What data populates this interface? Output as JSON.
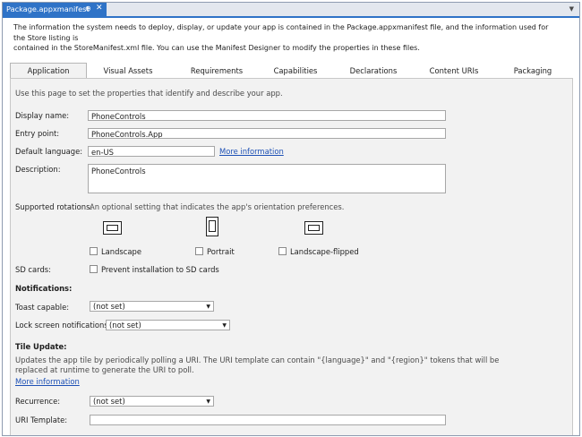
{
  "document_tab": {
    "title": "Package.appxmanifest",
    "pin_glyph": "⊕",
    "close_glyph": "✕"
  },
  "window": {
    "menu_glyph": "▼"
  },
  "intro": {
    "line1": "The information the system needs to deploy, display, or update your app is contained in the Package.appxmanifest file, and the information used for the Store listing is",
    "line2": "contained in the StoreManifest.xml file. You can use the Manifest Designer to modify the properties in these files."
  },
  "tabs": [
    "Application",
    "Visual Assets",
    "Requirements",
    "Capabilities",
    "Declarations",
    "Content URIs",
    "Packaging"
  ],
  "active_tab": "Application",
  "panel": {
    "description": "Use this page to set the properties that identify and describe your app.",
    "display_name": {
      "label": "Display name:",
      "value": "PhoneControls"
    },
    "entry_point": {
      "label": "Entry point:",
      "value": "PhoneControls.App"
    },
    "default_language": {
      "label": "Default language:",
      "value": "en-US",
      "link": "More information"
    },
    "description_field": {
      "label": "Description:",
      "value": "PhoneControls"
    },
    "supported_rotations": {
      "label": "Supported rotations:",
      "hint": "An optional setting that indicates the app's orientation preferences.",
      "options": [
        {
          "label": "Landscape",
          "icon": "landscape-icon",
          "checked": false
        },
        {
          "label": "Portrait",
          "icon": "portrait-icon",
          "checked": false
        },
        {
          "label": "Landscape-flipped",
          "icon": "landscape-flipped-icon",
          "checked": false
        }
      ]
    },
    "sd_cards": {
      "label": "SD cards:",
      "option": "Prevent installation to SD cards",
      "checked": false
    },
    "notifications": {
      "heading": "Notifications:",
      "toast_label": "Toast capable:",
      "toast_value": "(not set)",
      "lock_label": "Lock screen notifications:",
      "lock_value": "(not set)"
    },
    "tile_update": {
      "heading": "Tile Update:",
      "desc_line1": "Updates the app tile by periodically polling a URI. The URI template can contain \"{language}\" and \"{region}\" tokens that will be",
      "desc_line2": "replaced at runtime to generate the URI to poll.",
      "link": "More information",
      "recurrence_label": "Recurrence:",
      "recurrence_value": "(not set)",
      "uri_label": "URI Template:",
      "uri_value": ""
    },
    "dropdown_glyph": "▼"
  }
}
